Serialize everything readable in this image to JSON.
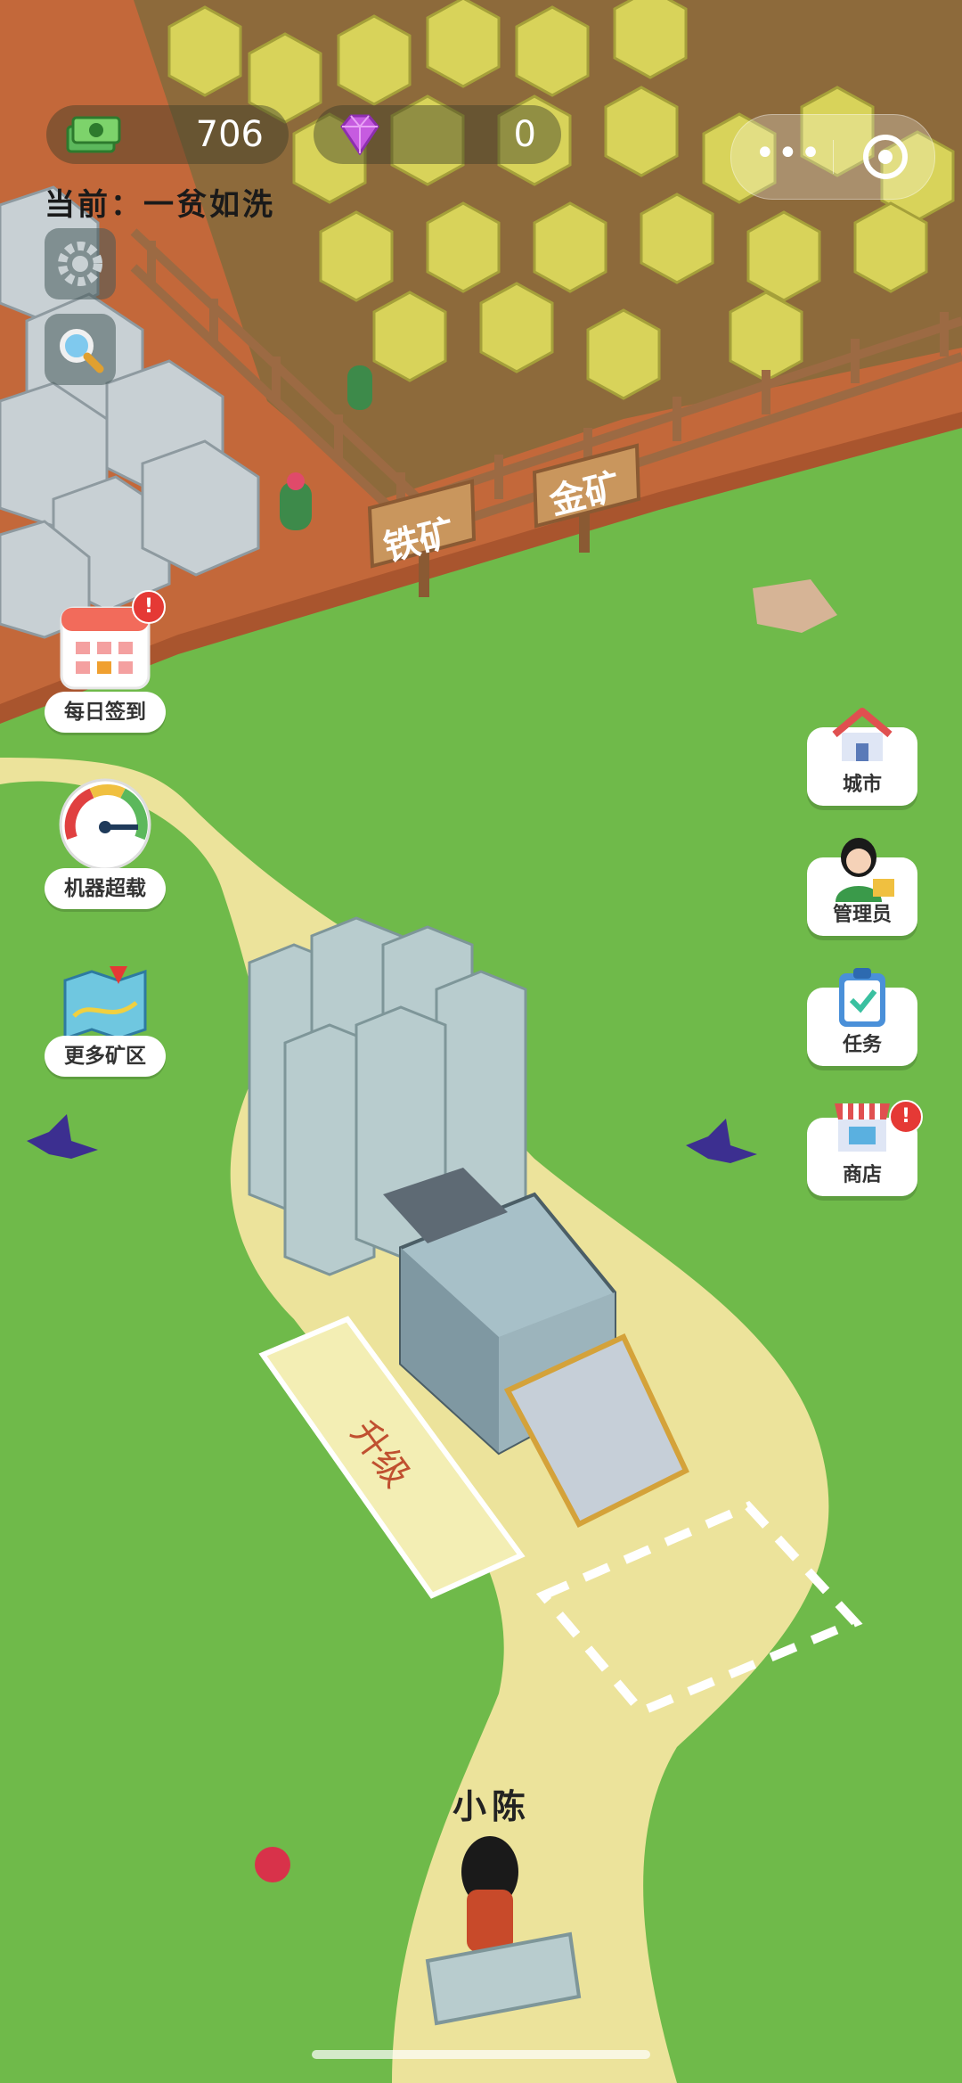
{
  "hud": {
    "money": "706",
    "gems": "0",
    "status_text": "当前：一贫如洗",
    "menu_dots": "•••"
  },
  "signs": {
    "iron_mine": "铁矿",
    "gold_mine": "金矿",
    "upgrade_zone": "升级"
  },
  "left_buttons": {
    "daily_checkin": "每日签到",
    "machine_overload": "机器超载",
    "more_mines": "更多矿区",
    "checkin_badge": "!"
  },
  "right_buttons": {
    "city": "城市",
    "manager": "管理员",
    "tasks": "任务",
    "shop": "商店",
    "shop_badge": "!"
  },
  "player": {
    "name": "小陈"
  },
  "colors": {
    "grass": "#6fba4a",
    "path": "#ece39b",
    "dirt": "#c3683a",
    "gold_ore": "#d7d45a",
    "fence": "#9c6a43",
    "badge": "#e53935"
  }
}
